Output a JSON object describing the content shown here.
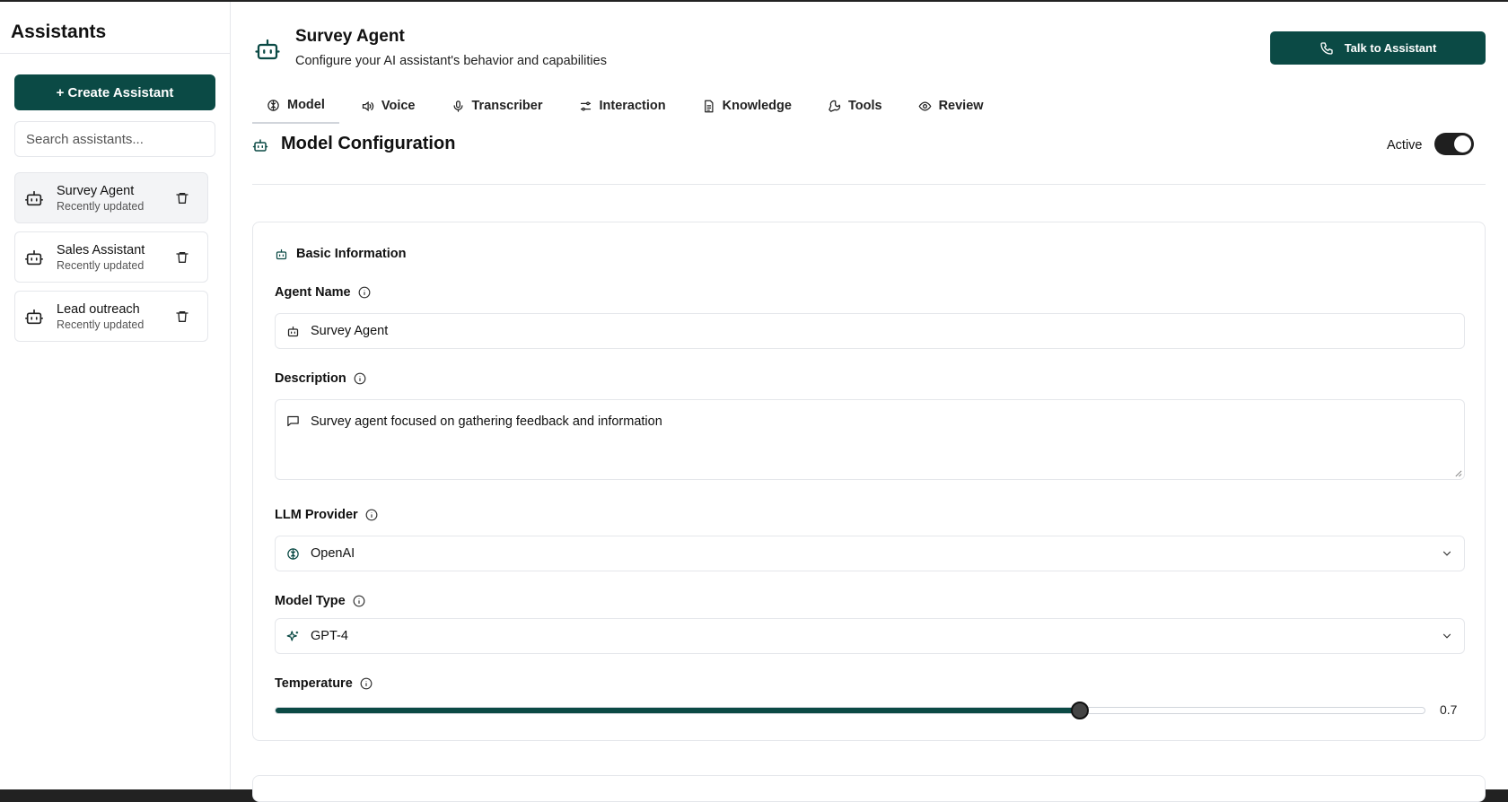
{
  "sidebar": {
    "title": "Assistants",
    "create_label": "+ Create Assistant",
    "search_placeholder": "Search assistants...",
    "items": [
      {
        "name": "Survey Agent",
        "sub": "Recently updated"
      },
      {
        "name": "Sales Assistant",
        "sub": "Recently updated"
      },
      {
        "name": "Lead outreach",
        "sub": "Recently updated"
      }
    ]
  },
  "header": {
    "title": "Survey Agent",
    "subtitle": "Configure your AI assistant's behavior and capabilities",
    "talk_label": "Talk to Assistant"
  },
  "tabs": [
    {
      "label": "Model",
      "icon": "brain-icon"
    },
    {
      "label": "Voice",
      "icon": "speaker-icon"
    },
    {
      "label": "Transcriber",
      "icon": "microphone-icon"
    },
    {
      "label": "Interaction",
      "icon": "sliders-icon"
    },
    {
      "label": "Knowledge",
      "icon": "document-icon"
    },
    {
      "label": "Tools",
      "icon": "wrench-icon"
    },
    {
      "label": "Review",
      "icon": "eye-icon"
    }
  ],
  "section": {
    "title": "Model Configuration",
    "active_label": "Active",
    "active": true
  },
  "card": {
    "heading": "Basic Information",
    "agent_name_label": "Agent Name",
    "agent_name_value": "Survey Agent",
    "description_label": "Description",
    "description_value": "Survey agent focused on gathering feedback and information",
    "provider_label": "LLM Provider",
    "provider_value": "OpenAI",
    "model_label": "Model Type",
    "model_value": "GPT-4",
    "temperature_label": "Temperature",
    "temperature_value": "0.7",
    "temperature_fraction": 0.7
  },
  "colors": {
    "accent": "#0b4a45"
  }
}
